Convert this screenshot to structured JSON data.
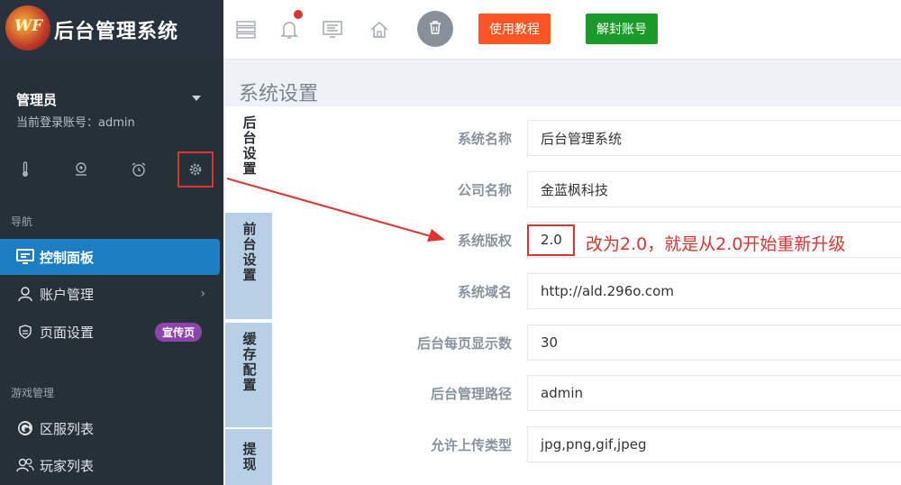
{
  "brand": {
    "logo_text": "WF",
    "title": "后台管理系统"
  },
  "user": {
    "name": "管理员",
    "account": "当前登录账号：admin"
  },
  "quick_icons": [
    "thermometer-icon",
    "pin-icon",
    "alarm-icon",
    "gear-icon"
  ],
  "nav": {
    "section_label": "导航",
    "items": [
      {
        "label": "控制面板",
        "icon": "dashboard-icon",
        "active": true
      },
      {
        "label": "账户管理",
        "icon": "user-icon"
      },
      {
        "label": "页面设置",
        "icon": "shield-icon",
        "badge": "宣传页"
      }
    ]
  },
  "game": {
    "section_label": "游戏管理",
    "items": [
      {
        "label": "区服列表",
        "icon": "g-circle-icon"
      },
      {
        "label": "玩家列表",
        "icon": "users-icon"
      }
    ]
  },
  "topbar": {
    "tutorial_label": "使用教程",
    "unlock_label": "解封账号"
  },
  "page": {
    "title": "系统设置",
    "tabs": [
      "后台设置",
      "前台设置",
      "缓存配置",
      "提现"
    ],
    "fields": [
      {
        "label": "系统名称",
        "value": "后台管理系统"
      },
      {
        "label": "公司名称",
        "value": "金蓝枫科技"
      },
      {
        "label": "系统版权",
        "value": "2.0"
      },
      {
        "label": "系统域名",
        "value": "http://ald.296o.com"
      },
      {
        "label": "后台每页显示数",
        "value": "30"
      },
      {
        "label": "后台管理路径",
        "value": "admin"
      },
      {
        "label": "允许上传类型",
        "value": "jpg,png,gif,jpeg"
      }
    ],
    "annotation": "改为2.0，就是从2.0开始重新升级"
  },
  "colors": {
    "sidebar": "#263039",
    "active_nav": "#1e7ec3",
    "orange": "#fa5522",
    "green": "#1a9a28",
    "annotation": "#e0322f"
  }
}
